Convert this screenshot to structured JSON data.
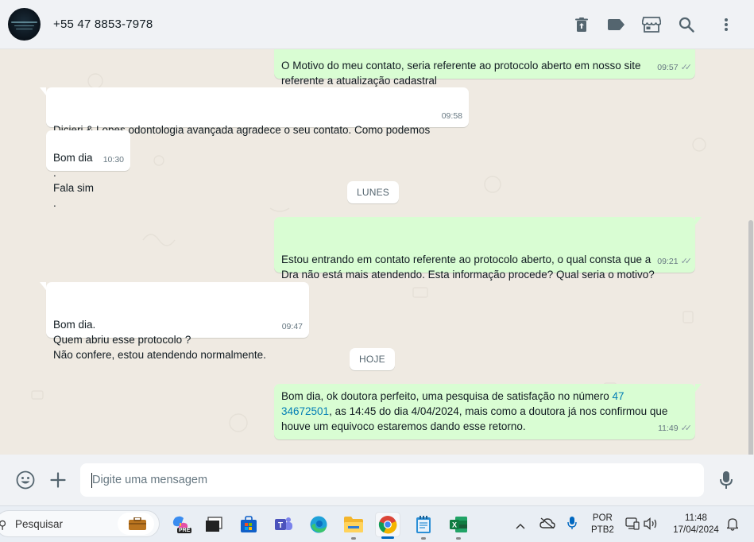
{
  "header": {
    "contact_name": "+55 47 8853-7978",
    "icons": [
      "trash-icon",
      "label-icon",
      "store-icon",
      "search-icon",
      "menu-dots-icon"
    ]
  },
  "messages": [
    {
      "dir": "out",
      "text": "O Motivo do meu contato, seria referente ao protocolo aberto em nosso site\nreferente a atualização cadastral",
      "time": "09:57",
      "ticks": "✓✓"
    },
    {
      "dir": "in",
      "text": "Dicieri & Lopes odontologia avançada agradece o seu contato. Como podemos\najudar?",
      "time": "09:58"
    },
    {
      "dir": "in",
      "text": "Bom dia .\nFala sim .",
      "time": "10:30"
    },
    {
      "dir": "out",
      "text": "Estou entrando em contato referente ao protocolo aberto, o qual consta que a\nDra não está mais atendendo. Esta informação procede? Qual seria o motivo?",
      "time": "09:21",
      "ticks": "✓✓"
    },
    {
      "dir": "in",
      "text": "Bom dia.\nQuem abriu esse protocolo ?\nNão confere, estou atendendo normalmente.",
      "time": "09:47"
    },
    {
      "dir": "out",
      "text_before": "Bom dia, ok doutora perfeito, uma pesquisa de satisfação no número ",
      "link_part1": "47",
      "link_part2": "34672501",
      "text_after": ", as 14:45 do dia 4/04/2024, mais como a doutora já nos confirmou que\nhouve um equivoco estaremos dando esse retorno.",
      "time": "11:49",
      "ticks": "✓✓"
    }
  ],
  "day_chips": [
    "LUNES",
    "HOJE"
  ],
  "composer": {
    "placeholder": "Digite uma mensagem",
    "icons": [
      "emoji-icon",
      "plus-icon",
      "microphone-icon"
    ]
  },
  "taskbar": {
    "search_label": "Pesquisar",
    "apps": [
      "briefcase-icon",
      "copilot-icon",
      "task-view-icon",
      "microsoft-store-icon",
      "teams-icon",
      "edge-icon",
      "file-explorer-icon",
      "chrome-icon",
      "notepad-icon",
      "excel-icon"
    ],
    "copilot_badge": "PRE",
    "language_line1": "POR",
    "language_line2": "PTB2",
    "clock_time": "11:48",
    "clock_date": "17/04/2024"
  }
}
